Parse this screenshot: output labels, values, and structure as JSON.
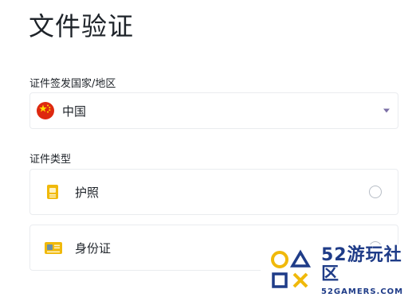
{
  "page": {
    "title": "文件验证"
  },
  "issuer": {
    "label": "证件签发国家/地区",
    "selected": "中国",
    "flag_icon": "china-flag-icon"
  },
  "doc_type": {
    "label": "证件类型",
    "options": [
      {
        "label": "护照",
        "icon": "passport-icon",
        "selected": false
      },
      {
        "label": "身份证",
        "icon": "id-card-icon",
        "selected": false
      }
    ]
  },
  "watermark": {
    "main": "52游玩社区",
    "sub": "52GAMERS.COM"
  },
  "colors": {
    "text": "#1e2329",
    "border": "#eaecef",
    "accent_yellow": "#f0b90b",
    "flag_red": "#de2910",
    "watermark_blue": "#1f3c88"
  }
}
